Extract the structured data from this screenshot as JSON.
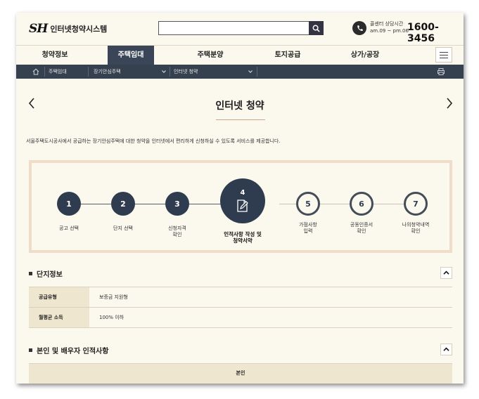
{
  "header": {
    "logo_mark": "SH",
    "logo_text": "인터넷청약시스템",
    "search_placeholder": "",
    "call_label_line1": "콜센터 상담시간",
    "call_label_line2": "am.09 ~ pm.06",
    "call_number": "1600-3456"
  },
  "nav": {
    "items": [
      {
        "label": "청약정보"
      },
      {
        "label": "주택임대"
      },
      {
        "label": "주택분양"
      },
      {
        "label": "토지공급"
      },
      {
        "label": "상가/공장"
      }
    ],
    "active_index": 1
  },
  "breadcrumb": {
    "items": [
      "주택임대",
      "장기안심주택",
      "인터넷 청약"
    ]
  },
  "page": {
    "title": "인터넷 청약",
    "intro": "서울주택도시공사에서 공급하는 장기안심주택에 대한 청약을 인터넷에서 편리하게 신청하실 수 있도록 서비스를 제공합니다."
  },
  "steps": [
    {
      "num": "1",
      "label_l1": "공고 선택",
      "label_l2": "",
      "label_l3": "",
      "state": "done"
    },
    {
      "num": "2",
      "label_l1": "단지 선택",
      "label_l2": "",
      "label_l3": "",
      "state": "done"
    },
    {
      "num": "3",
      "label_l1": "신청자격",
      "label_l2": "확인",
      "label_l3": "",
      "state": "done"
    },
    {
      "num": "4",
      "label_l1": "인적사항 작성 및",
      "label_l2": "청약서약",
      "label_l3": "",
      "state": "current"
    },
    {
      "num": "5",
      "label_l1": "가점사항",
      "label_l2": "입력",
      "label_l3": "",
      "state": "todo"
    },
    {
      "num": "6",
      "label_l1": "공동인증서",
      "label_l2": "확인",
      "label_l3": "",
      "state": "todo"
    },
    {
      "num": "7",
      "label_l1": "나의청약내역",
      "label_l2": "확인",
      "label_l3": "",
      "state": "todo"
    }
  ],
  "section1": {
    "title": "단지정보",
    "rows": [
      {
        "label": "공급유형",
        "value": "보증금 지원형"
      },
      {
        "label": "월평균 소득",
        "value": "100% 이하"
      }
    ]
  },
  "section2": {
    "title": "본인 및 배우자 인적사항",
    "table_header": "본인"
  },
  "colors": {
    "accent": "#2f3b4e",
    "breadcrumb_bg": "#36414f",
    "background": "#fbf8ee",
    "th_bg": "#efe6cf",
    "step_border": "#efdcc9"
  }
}
